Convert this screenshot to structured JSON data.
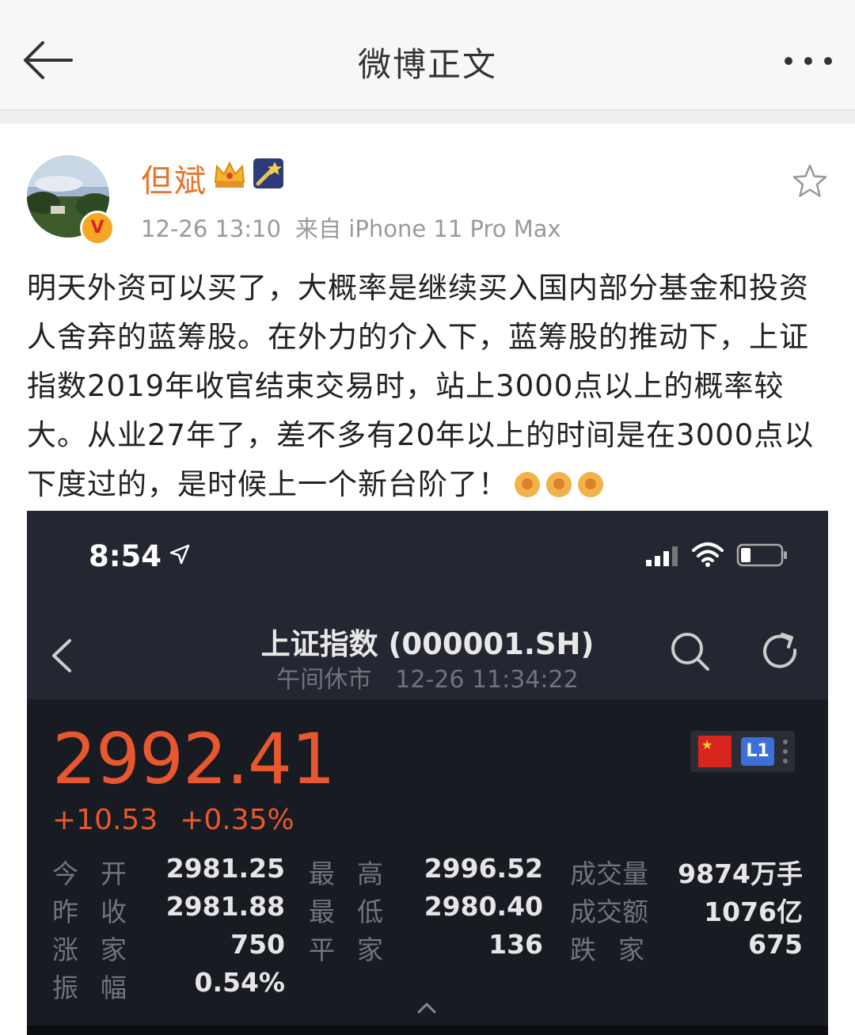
{
  "nav": {
    "title": "微博正文"
  },
  "post": {
    "author": "但斌",
    "verified_mark": "V",
    "time": "12-26 13:10",
    "source": "来自 iPhone 11 Pro Max",
    "text": "明天外资可以买了，大概率是继续买入国内部分基金和投资人舍弃的蓝筹股。在外力的介入下，蓝筹股的推动下，上证指数2019年收官结束交易时，站上3000点以上的概率较大。从业27年了，差不多有20年以上的时间是在3000点以下度过的，是时候上一个新台阶了！"
  },
  "screenshot": {
    "status_time": "8:54",
    "title": "上证指数 (000001.SH)",
    "market_status": "午间休市",
    "quote_time": "12-26 11:34:22",
    "price": "2992.41",
    "change": "+10.53",
    "change_pct": "+0.35%",
    "level_tag": "L1",
    "price_color": "#e8582f",
    "stats": {
      "open_label": "今开",
      "open": "2981.25",
      "prev_close_label": "昨收",
      "prev_close": "2981.88",
      "rise_label": "涨家",
      "rise": "750",
      "amplitude_label": "振幅",
      "amplitude": "0.54%",
      "high_label": "最高",
      "high": "2996.52",
      "low_label": "最低",
      "low": "2980.40",
      "flat_label": "平家",
      "flat": "136",
      "volume_label": "成交量",
      "volume": "9874万手",
      "turnover_label": "成交额",
      "turnover": "1076亿",
      "fall_label": "跌家",
      "fall": "675"
    }
  }
}
